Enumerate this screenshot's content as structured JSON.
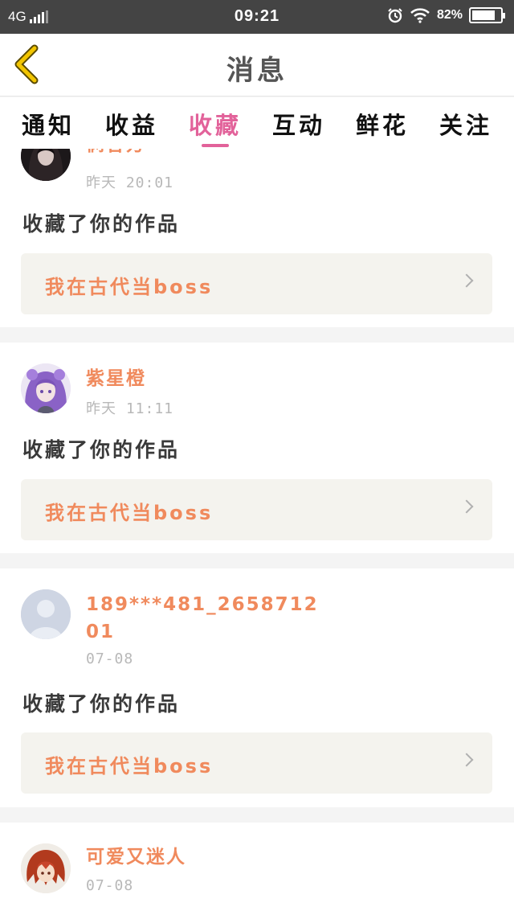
{
  "status_bar": {
    "network": "4G",
    "time": "09:21",
    "battery": "82%",
    "battery_level": 0.82,
    "icons": [
      "signal-icon",
      "alarm-icon",
      "wifi-icon",
      "battery-icon"
    ]
  },
  "header": {
    "title": "消息",
    "back_icon": "chevron-left-icon",
    "accent": "#f2c500"
  },
  "tabs": [
    {
      "label": "通知",
      "active": false
    },
    {
      "label": "收益",
      "active": false
    },
    {
      "label": "收藏",
      "active": true
    },
    {
      "label": "互动",
      "active": false
    },
    {
      "label": "鲜花",
      "active": false
    },
    {
      "label": "关注",
      "active": false
    }
  ],
  "colors": {
    "active_tab": "#e2629a",
    "username": "#f08a5d",
    "work_title": "#f08a5d",
    "timestamp": "#b8b8b8"
  },
  "notifications": [
    {
      "user": "俩各方",
      "time": "昨天 20:01",
      "action": "收藏了你的作品",
      "work": "我在古代当boss"
    },
    {
      "user": "紫星橙",
      "time": "昨天 11:11",
      "action": "收藏了你的作品",
      "work": "我在古代当boss"
    },
    {
      "user": "189***481_265871201",
      "time": "07-08",
      "action": "收藏了你的作品",
      "work": "我在古代当boss"
    },
    {
      "user": "可爱又迷人",
      "time": "07-08",
      "action": "",
      "work": ""
    }
  ]
}
